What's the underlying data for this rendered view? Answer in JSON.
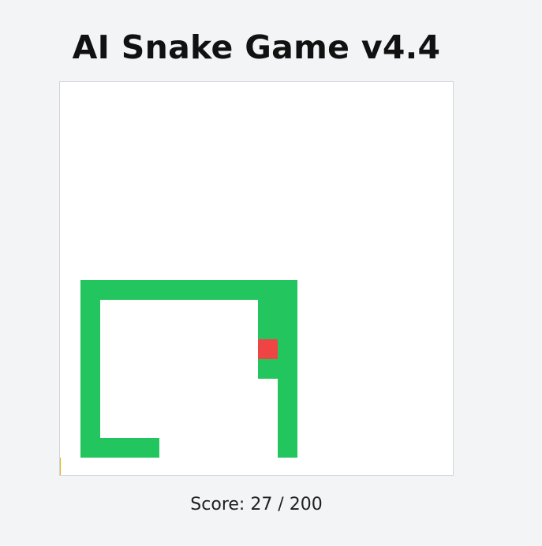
{
  "game": {
    "title": "AI Snake Game v4.4"
  },
  "board": {
    "grid_cells": 20,
    "snake_color": "#22c55e",
    "food_color": "#ef4444",
    "bonus_color": "#eab308",
    "snake": [
      [
        11,
        15
      ],
      [
        11,
        14
      ],
      [
        11,
        13
      ],
      [
        11,
        12
      ],
      [
        11,
        11
      ],
      [
        10,
        11
      ],
      [
        9,
        11
      ],
      [
        8,
        11
      ],
      [
        7,
        11
      ],
      [
        6,
        11
      ],
      [
        5,
        11
      ],
      [
        4,
        11
      ],
      [
        3,
        11
      ],
      [
        2,
        11
      ],
      [
        2,
        12
      ],
      [
        2,
        13
      ],
      [
        2,
        14
      ],
      [
        2,
        15
      ],
      [
        2,
        16
      ],
      [
        2,
        17
      ],
      [
        2,
        18
      ],
      [
        2,
        19
      ],
      [
        3,
        19
      ],
      [
        4,
        19
      ],
      [
        5,
        19
      ],
      [
        12,
        19
      ],
      [
        12,
        18
      ],
      [
        12,
        17
      ],
      [
        12,
        16
      ],
      [
        12,
        15
      ],
      [
        12,
        14
      ],
      [
        12,
        13
      ],
      [
        12,
        12
      ],
      [
        12,
        11
      ]
    ],
    "food": [
      [
        11,
        14
      ]
    ],
    "bonus": [
      [
        0,
        20
      ]
    ]
  },
  "score": {
    "text": "Score: 27 / 200"
  }
}
